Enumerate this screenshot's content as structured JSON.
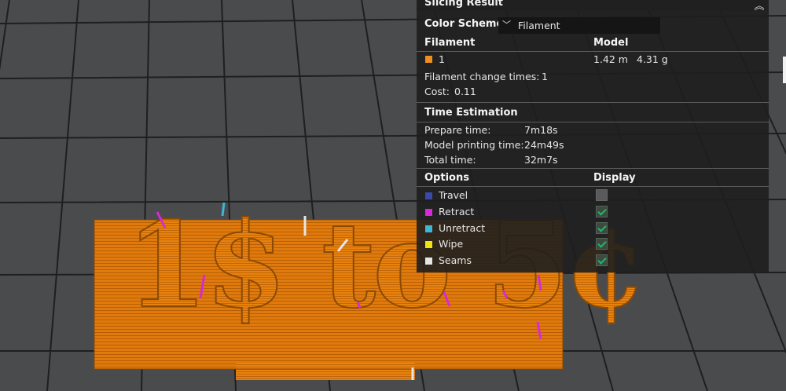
{
  "panel": {
    "title": "Slicing Result",
    "color_scheme_label": "Color Scheme",
    "color_scheme_value": "Filament",
    "filament_header": "Filament",
    "model_header": "Model",
    "filament_id": "1",
    "filament_color": "#f0901c",
    "filament_length": "1.42 m",
    "filament_weight": "4.31 g",
    "change_times_label": "Filament change times:",
    "change_times_value": "1",
    "cost_label": "Cost:",
    "cost_value": "0.11",
    "time_header": "Time Estimation",
    "prepare_label": "Prepare time:",
    "prepare_value": "7m18s",
    "model_print_label": "Model printing time:",
    "model_print_value": "24m49s",
    "total_label": "Total time:",
    "total_value": "32m7s",
    "options_header": "Options",
    "display_header": "Display",
    "options": [
      {
        "label": "Travel",
        "color": "#3b49a8",
        "checked": false
      },
      {
        "label": "Retract",
        "color": "#d62ad6",
        "checked": true
      },
      {
        "label": "Unretract",
        "color": "#3fb6d4",
        "checked": true
      },
      {
        "label": "Wipe",
        "color": "#f2e20e",
        "checked": true
      },
      {
        "label": "Seams",
        "color": "#e6e6e6",
        "checked": true
      }
    ]
  },
  "model": {
    "text": "1$ to 5¢",
    "color": "#e07a0c"
  }
}
